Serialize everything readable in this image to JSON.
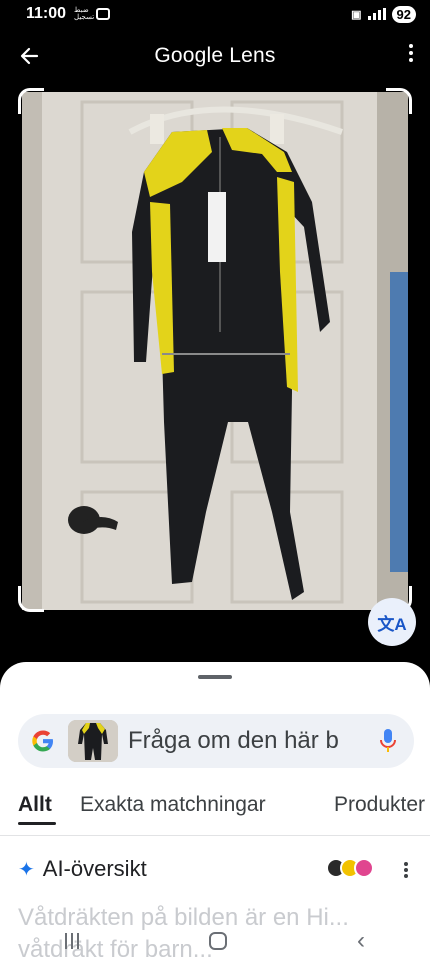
{
  "status_bar": {
    "time": "11:00",
    "notif_line1": "ضبط",
    "notif_line2": "تسجيل",
    "battery": "92"
  },
  "app_bar": {
    "title": "Google Lens",
    "back_icon": "arrow-back-icon",
    "menu_icon": "more-vert-icon"
  },
  "image": {
    "subject": "wetsuit-photo",
    "translate_icon": "translate-icon"
  },
  "sheet": {
    "search_placeholder": "Fråga om den här b",
    "tabs": [
      {
        "label": "Allt",
        "active": true
      },
      {
        "label": "Exakta matchningar",
        "active": false
      },
      {
        "label": "Produkter",
        "active": false
      }
    ],
    "ai_title": "AI-översikt",
    "ai_text": "Våtdräkten på bilden är en Hi... våtdräkt för barn..."
  },
  "colors": {
    "accent": "#1a73e8",
    "wetsuit_yellow": "#e3d31a",
    "wetsuit_black": "#1b1c1f"
  }
}
